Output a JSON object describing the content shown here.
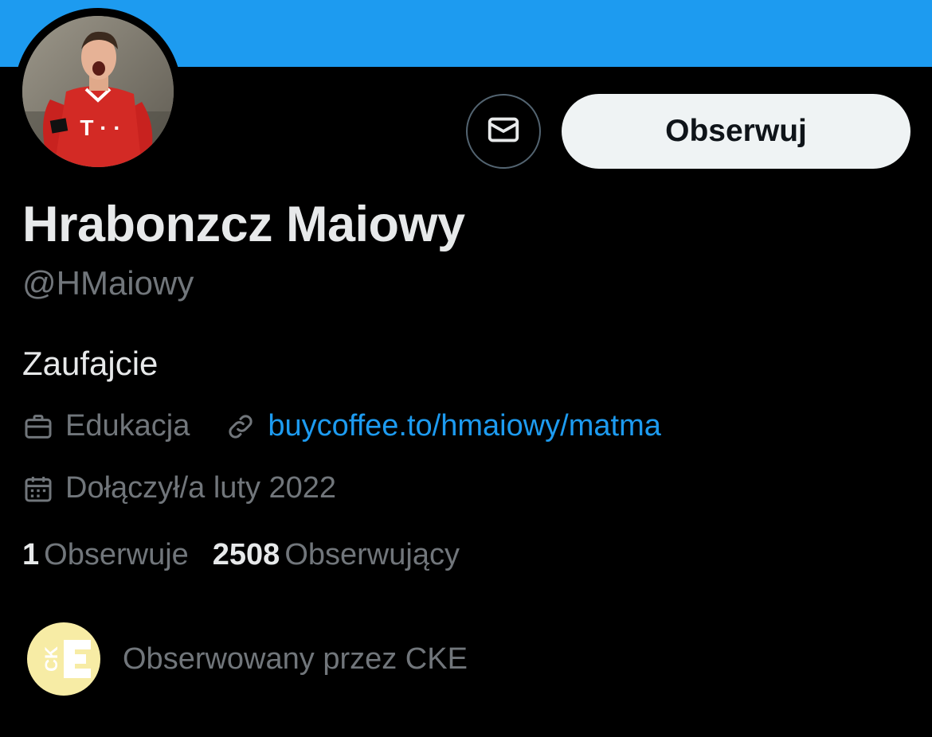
{
  "colors": {
    "banner": "#1d9bf0",
    "background": "#000000",
    "primary_text": "#e7e9ea",
    "secondary_text": "#71767b",
    "link": "#1d9bf0",
    "follow_button_bg": "#eff3f4",
    "follow_button_text": "#0f1419",
    "cke_logo_bg": "#f7eca5"
  },
  "header": {
    "banner_icon": "blue-banner",
    "avatar_icon": "profile-photo-footballer"
  },
  "actions": {
    "message_icon": "mail-envelope-icon",
    "follow_label": "Obserwuj"
  },
  "profile": {
    "display_name": "Hrabonzcz Maiowy",
    "handle": "@HMaiowy",
    "bio": "Zaufajcie",
    "category": "Edukacja",
    "category_icon": "briefcase-icon",
    "link": "buycoffee.to/hmaiowy/matma",
    "link_icon": "link-icon",
    "joined": "Dołączył/a luty 2022",
    "joined_icon": "calendar-icon"
  },
  "stats": {
    "following_count": "1",
    "following_label": "Obserwuje",
    "followers_count": "2508",
    "followers_label": "Obserwujący"
  },
  "followed_by": {
    "logo_text": "CKE",
    "text": "Obserwowany przez CKE"
  }
}
